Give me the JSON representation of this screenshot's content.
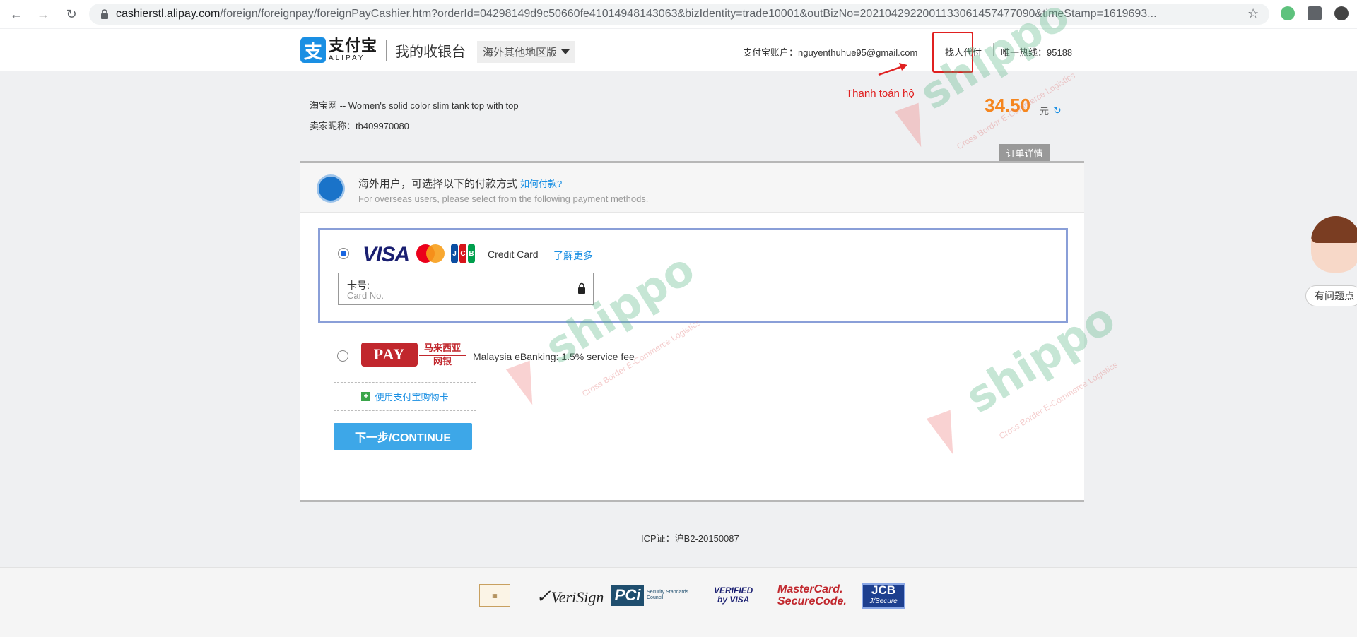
{
  "browser": {
    "url_host": "cashierstl.alipay.com",
    "url_path": "/foreign/foreignpay/foreignPayCashier.htm?orderId=04298149d9c50660fe41014948143063&bizIdentity=trade10001&outBizNo=2021042922001133061457477090&timeStamp=1619693..."
  },
  "header": {
    "logo_cn": "支付宝",
    "logo_en": "ALIPAY",
    "cashier_title": "我的收银台",
    "region_select": "海外其他地区版",
    "account_label": "支付宝账户：",
    "account_email": "nguyenthuhue95@gmail.com",
    "proxy_pay": "找人代付",
    "hotline": "唯一热线：95188"
  },
  "annotation": {
    "label": "Thanh toán hộ",
    "color": "#e02020"
  },
  "order": {
    "title": "淘宝网 -- Women's solid color slim tank top with top",
    "seller": "卖家昵称：tb409970080",
    "amount": "34.50",
    "currency": "元",
    "detail_button": "订单详情"
  },
  "payment": {
    "overseas_cn": "海外用户，可选择以下的付款方式",
    "how_to_pay": "如何付款?",
    "overseas_en": "For overseas users, please select from the following payment methods.",
    "credit_card": {
      "selected": true,
      "visa": "VISA",
      "jcb": [
        "J",
        "C",
        "B"
      ],
      "label": "Credit Card",
      "learn_more": "了解更多",
      "card_no_cn": "卡号:",
      "card_no_en": "Card No."
    },
    "mypay": {
      "selected": false,
      "logo": "PAY",
      "cn_top": "马来西亚",
      "cn_bottom": "网银",
      "label": "Malaysia eBanking: 1.5% service fee"
    },
    "gift_card": "使用支付宝购物卡",
    "continue_button": "下一步/CONTINUE"
  },
  "icp": "ICP证：沪B2-20150087",
  "footer": {
    "verisign": "VeriSign",
    "pci": "PCi",
    "pci_sub": "Security Standards Council",
    "vbv_line1": "VERIFIED",
    "vbv_line2": "by VISA",
    "mc_line1": "MasterCard.",
    "mc_line2": "SecureCode.",
    "jcb_line1": "JCB",
    "jcb_line2": "J/Secure"
  },
  "support": {
    "help_text": "有问题点"
  },
  "watermark": {
    "word": "shippo",
    "tag": "Cross Border E-Commerce Logistics"
  },
  "colors": {
    "accent": "#1a8fe3",
    "amount": "#f5861f",
    "continue": "#3da7e8",
    "selected_box": "#8a9fd8"
  }
}
